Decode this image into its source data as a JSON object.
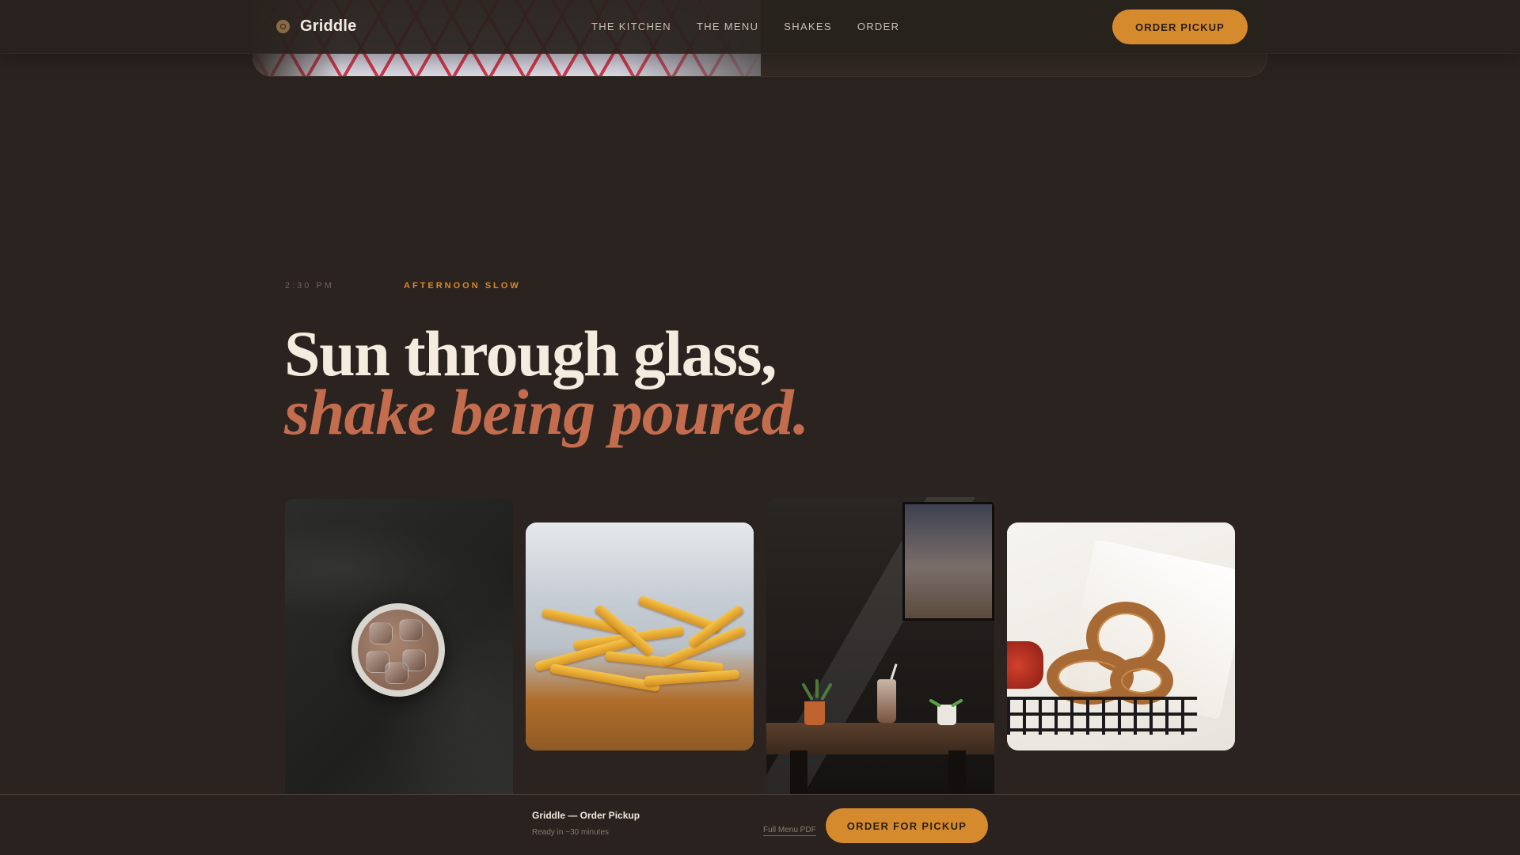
{
  "brand": {
    "name": "Griddle",
    "icon": "griddle-logo-icon"
  },
  "nav": {
    "links": [
      "THE KITCHEN",
      "THE MENU",
      "SHAKES",
      "ORDER"
    ],
    "cta_label": "ORDER PICKUP"
  },
  "section": {
    "time": "2:30 PM",
    "tag": "AFTERNOON SLOW",
    "headline_line1": "Sun through glass,",
    "headline_line2": "shake being poured."
  },
  "gallery": {
    "images": [
      "iced-coffee-photo",
      "fries-photo",
      "cafe-shake-photo",
      "onion-rings-photo"
    ]
  },
  "bottom_bar": {
    "title": "Griddle — Order Pickup",
    "subtitle": "Ready in ~30 minutes",
    "menu_link": "Full Menu PDF",
    "cta_label": "ORDER FOR PICKUP"
  },
  "colors": {
    "background": "#2b231f",
    "accent": "#d58a2e",
    "headline_italic": "#c46c4e",
    "headline": "#f4ecdf"
  }
}
